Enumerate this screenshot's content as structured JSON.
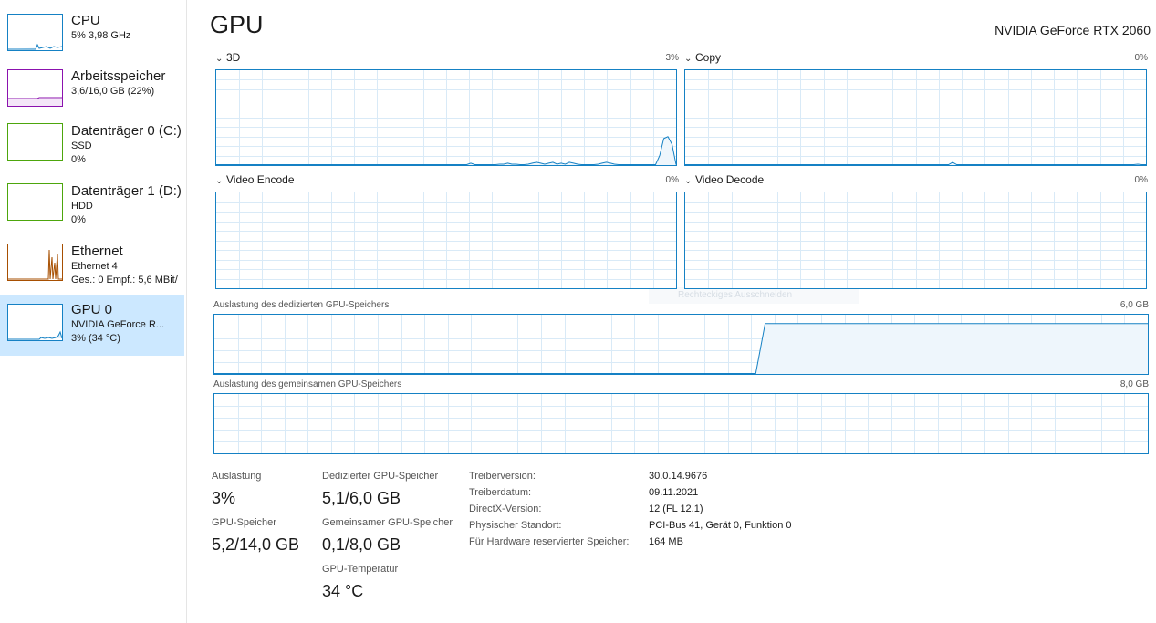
{
  "sidebar": {
    "items": [
      {
        "title": "CPU",
        "line1": "5%  3,98 GHz",
        "line2": "",
        "color": "#1581c4"
      },
      {
        "title": "Arbeitsspeicher",
        "line1": "3,6/16,0 GB (22%)",
        "line2": "",
        "color": "#8b12ae"
      },
      {
        "title": "Datenträger 0 (C:)",
        "line1": "SSD",
        "line2": "0%",
        "color": "#4da60c"
      },
      {
        "title": "Datenträger 1 (D:)",
        "line1": "HDD",
        "line2": "0%",
        "color": "#4da60c"
      },
      {
        "title": "Ethernet",
        "line1": "Ethernet 4",
        "line2": "Ges.: 0  Empf.: 5,6 MBit/",
        "color": "#a74f01"
      },
      {
        "title": "GPU 0",
        "line1": "NVIDIA GeForce R...",
        "line2": "3% (34 °C)",
        "color": "#1581c4"
      }
    ]
  },
  "header": {
    "title": "GPU",
    "device": "NVIDIA GeForce RTX 2060"
  },
  "engines": [
    {
      "label": "3D",
      "percent": "3%",
      "trace": [
        0,
        0,
        0,
        0,
        0,
        0,
        0,
        0,
        0,
        0,
        0,
        0,
        0,
        0,
        0,
        0,
        0,
        0,
        0,
        0,
        0,
        0,
        0,
        0,
        0,
        0,
        0,
        0,
        0,
        0,
        0,
        0,
        0,
        0,
        0,
        0,
        0,
        0,
        0,
        0,
        0,
        0,
        0,
        0,
        0,
        0,
        0,
        0,
        0,
        0,
        0,
        0,
        0,
        0,
        0,
        0,
        0,
        0,
        0,
        0,
        0,
        0,
        2,
        0,
        0,
        0,
        0,
        0,
        0,
        1,
        1,
        2,
        1,
        1,
        0,
        0,
        1,
        2,
        3,
        2,
        1,
        2,
        3,
        1,
        2,
        1,
        3,
        2,
        1,
        0,
        0,
        0,
        0,
        1,
        2,
        3,
        2,
        1,
        0,
        0,
        0,
        0,
        0,
        0,
        0,
        0,
        0,
        0,
        10,
        28,
        30,
        22,
        0
      ]
    },
    {
      "label": "Copy",
      "percent": "0%",
      "trace": [
        0,
        0,
        0,
        0,
        0,
        0,
        0,
        0,
        0,
        0,
        0,
        0,
        0,
        0,
        0,
        0,
        0,
        0,
        0,
        0,
        0,
        0,
        0,
        0,
        0,
        0,
        0,
        0,
        0,
        0,
        0,
        0,
        0,
        0,
        0,
        0,
        0,
        0,
        0,
        0,
        0,
        0,
        0,
        0,
        0,
        0,
        0,
        0,
        0,
        0,
        0,
        0,
        0,
        0,
        0,
        0,
        0,
        0,
        0,
        0,
        0,
        0,
        0,
        0,
        0,
        3,
        0,
        0,
        0,
        0,
        0,
        0,
        0,
        0,
        0,
        0,
        0,
        0,
        0,
        0,
        0,
        0,
        0,
        0,
        0,
        0,
        0,
        0,
        0,
        0,
        0,
        0,
        0,
        0,
        0,
        0,
        0,
        0,
        0,
        0,
        0,
        0,
        0,
        0,
        0,
        0,
        0,
        0,
        0,
        0,
        1,
        0,
        0
      ]
    },
    {
      "label": "Video Encode",
      "percent": "0%",
      "trace": []
    },
    {
      "label": "Video Decode",
      "percent": "0%",
      "trace": []
    }
  ],
  "memory_graphs": [
    {
      "label": "Auslastung des dedizierten GPU-Speichers",
      "max": "6,0 GB",
      "trace": [
        0,
        0,
        0,
        0,
        0,
        0,
        0,
        0,
        0,
        0,
        0,
        0,
        0,
        0,
        0,
        0,
        0,
        0,
        0,
        0,
        0,
        0,
        0,
        0,
        0,
        0,
        0,
        0,
        0,
        0,
        0,
        0,
        0,
        0,
        0,
        0,
        0,
        0,
        0,
        0,
        0,
        0,
        0,
        0,
        0,
        0,
        0,
        0,
        0,
        0,
        0,
        0,
        0,
        0,
        0,
        0,
        0,
        0,
        0,
        85,
        85,
        85,
        85,
        85,
        85,
        85,
        85,
        85,
        85,
        85,
        85,
        85,
        85,
        85,
        85,
        85,
        85,
        85,
        85,
        85,
        85,
        85,
        85,
        85,
        85,
        85,
        85,
        85,
        85,
        85,
        85,
        85,
        85,
        85,
        85,
        85,
        85,
        85,
        85,
        85,
        85
      ]
    },
    {
      "label": "Auslastung des gemeinsamen GPU-Speichers",
      "max": "8,0 GB",
      "trace": []
    }
  ],
  "stats": {
    "utilization": {
      "label": "Auslastung",
      "value": "3%"
    },
    "gpu_memory": {
      "label": "GPU-Speicher",
      "value": "5,2/14,0 GB"
    },
    "dedicated": {
      "label": "Dedizierter GPU-Speicher",
      "value": "5,1/6,0 GB"
    },
    "shared": {
      "label": "Gemeinsamer GPU-Speicher",
      "value": "0,1/8,0 GB"
    },
    "temperature": {
      "label": "GPU-Temperatur",
      "value": "34 °C"
    }
  },
  "info": [
    {
      "key": "Treiberversion:",
      "value": "30.0.14.9676"
    },
    {
      "key": "Treiberdatum:",
      "value": "09.11.2021"
    },
    {
      "key": "DirectX-Version:",
      "value": "12 (FL 12.1)"
    },
    {
      "key": "Physischer Standort:",
      "value": "PCI-Bus 41, Gerät 0, Funktion 0"
    },
    {
      "key": "Für Hardware reservierter Speicher:",
      "value": "164 MB"
    }
  ],
  "ghost_tooltip": "Rechteckiges Ausschneiden"
}
